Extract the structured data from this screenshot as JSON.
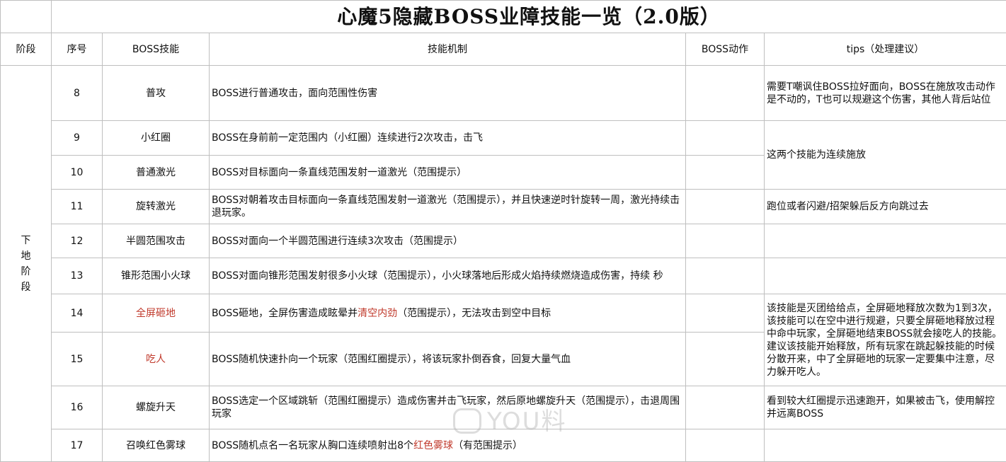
{
  "title": "心魔5隐藏BOSS业障技能一览（2.0版）",
  "headers": {
    "phase": "阶段",
    "index": "序号",
    "skill": "BOSS技能",
    "mechanic": "技能机制",
    "action": "BOSS动作",
    "tips": "tips（处理建议）"
  },
  "phase_label": "下地阶段",
  "rows": [
    {
      "index": "8",
      "skill": "普攻",
      "mechanic": "BOSS进行普通攻击，面向范围性伤害"
    },
    {
      "index": "9",
      "skill": "小红圈",
      "mechanic": "BOSS在身前前一定范围内（小红圈）连续进行2次攻击，击飞"
    },
    {
      "index": "10",
      "skill": "普通激光",
      "mechanic": "BOSS对目标面向一条直线范围发射一道激光（范围提示）"
    },
    {
      "index": "11",
      "skill": "旋转激光",
      "mechanic": "BOSS对朝着攻击目标面向一条直线范围发射一道激光（范围提示），并且快速逆时针旋转一周，激光持续击退玩家。"
    },
    {
      "index": "12",
      "skill": "半圆范围攻击",
      "mechanic": "BOSS对面向一个半圆范围进行连续3次攻击（范围提示）"
    },
    {
      "index": "13",
      "skill": "锥形范围小火球",
      "mechanic": "BOSS对面向锥形范围发射很多小火球（范围提示），小火球落地后形成火焰持续燃烧造成伤害，持续 秒"
    },
    {
      "index": "14",
      "skill": "全屏砸地",
      "mechanic_pre": "BOSS砸地，全屏伤害造成眩晕并",
      "mechanic_red": "清空内劲",
      "mechanic_post": "（范围提示），无法攻击到空中目标"
    },
    {
      "index": "15",
      "skill": "吃人",
      "mechanic": "BOSS随机快速扑向一个玩家（范围红圈提示），将该玩家扑倒吞食，回复大量气血"
    },
    {
      "index": "16",
      "skill": "螺旋升天",
      "mechanic": "BOSS选定一个区域跳斩（范围红圈提示）造成伤害并击飞玩家，然后原地螺旋升天（范围提示），击退周围玩家"
    },
    {
      "index": "17",
      "skill": "召唤红色雾球",
      "mechanic_pre": "BOSS随机点名一名玩家从胸口连续喷射出8个",
      "mechanic_red": "红色雾球",
      "mechanic_post": "（有范围提示）"
    }
  ],
  "tips": {
    "t8": "需要T嘲讽住BOSS拉好面向，BOSS在施放攻击动作是不动的，T也可以规避这个伤害，其他人背后站位",
    "t9_10": "这两个技能为连续施放",
    "t11": "跑位或者闪避/招架躲后反方向跳过去",
    "t14_15": "该技能是灭团给给点，全屏砸地释放次数为1到3次，该技能可以在空中进行规避，只要全屏砸地释放过程中命中玩家，全屏砸地结束BOSS就会接吃人的技能。建议该技能开始释放，所有玩家在跳起躲技能的时候分散开来，中了全屏砸地的玩家一定要集中注意，尽力躲开吃人。",
    "t16": "看到较大红圈提示迅速跑开，如果被击飞，使用解控并远离BOSS"
  },
  "watermark": "YOU料",
  "colors": {
    "highlight_red": "#c0392b",
    "grid": "#bfbfbf"
  }
}
